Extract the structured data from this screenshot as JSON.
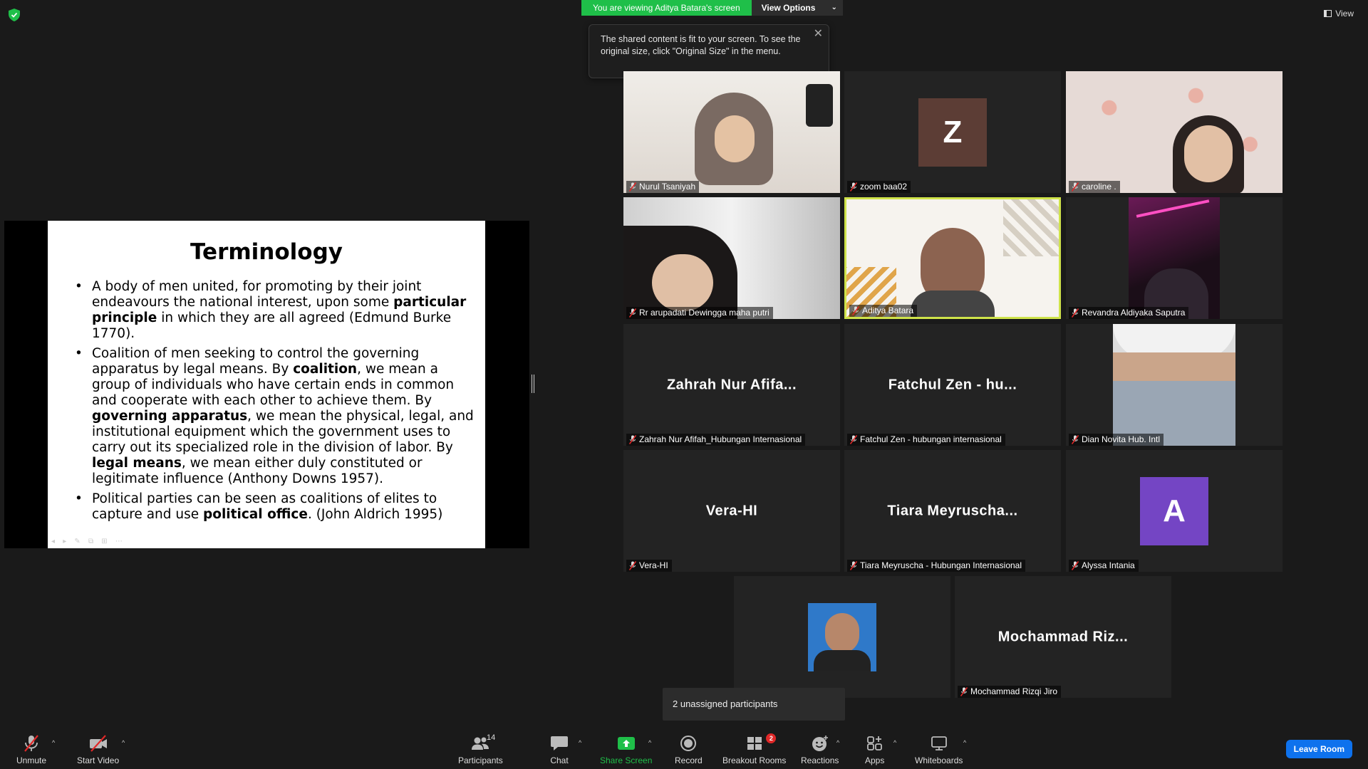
{
  "banner": {
    "viewing_text": "You are viewing Aditya Batara's screen",
    "view_options_label": "View Options"
  },
  "tooltip": {
    "text": "The shared content is fit to your screen. To see the original size, click \"Original Size\" in the menu."
  },
  "view_button_label": "View",
  "slide": {
    "title": "Terminology",
    "bullets": [
      [
        {
          "t": "A body of men united, for promoting by their joint endeavours the national interest, upon some ",
          "b": false
        },
        {
          "t": "particular principle",
          "b": true
        },
        {
          "t": " in which they are all agreed (Edmund Burke 1770).",
          "b": false
        }
      ],
      [
        {
          "t": "Coalition of men seeking to control the governing apparatus by legal means. By ",
          "b": false
        },
        {
          "t": "coalition",
          "b": true
        },
        {
          "t": ", we mean a group of individuals who have certain ends in common and cooperate with each other to achieve them. By ",
          "b": false
        },
        {
          "t": "governing apparatus",
          "b": true
        },
        {
          "t": ", we mean the physical, legal, and institutional equipment which the government uses to carry out its specialized role in the division of labor. By ",
          "b": false
        },
        {
          "t": "legal means",
          "b": true
        },
        {
          "t": ", we mean either duly constituted or legitimate influence (Anthony Downs 1957).",
          "b": false
        }
      ],
      [
        {
          "t": "Political parties can be seen as coalitions of elites to capture and use ",
          "b": false
        },
        {
          "t": "political office",
          "b": true
        },
        {
          "t": ". (John Aldrich 1995)",
          "b": false
        }
      ]
    ]
  },
  "participants": [
    {
      "name": "Nurul Tsaniyah",
      "kind": "video"
    },
    {
      "name": "zoom baa02",
      "kind": "letter",
      "letter": "Z",
      "color": "#5c3d35"
    },
    {
      "name": "caroline .",
      "kind": "video"
    },
    {
      "name": "Rr arupadati Dewingga maha putri",
      "kind": "video"
    },
    {
      "name": "Aditya Batara",
      "kind": "video",
      "active": true
    },
    {
      "name": "Revandra Aldiyaka Saputra",
      "kind": "video"
    },
    {
      "name": "Zahrah Nur Afifah_Hubungan Internasional",
      "kind": "text",
      "display": "Zahrah Nur Afifa..."
    },
    {
      "name": "Fatchul Zen - hubungan internasional",
      "kind": "text",
      "display": "Fatchul Zen - hu..."
    },
    {
      "name": "Dian Novita Hub. Intl",
      "kind": "video"
    },
    {
      "name": "Vera-HI",
      "kind": "text",
      "display": "Vera-HI"
    },
    {
      "name": "Tiara Meyruscha - Hubungan Internasional",
      "kind": "text",
      "display": "Tiara Meyruscha..."
    },
    {
      "name": "Alyssa Intania",
      "kind": "letter",
      "letter": "A",
      "color": "#7445c4"
    },
    {
      "name": "",
      "kind": "photo"
    },
    {
      "name": "Mochammad Rizqi Jiro",
      "kind": "text",
      "display": "Mochammad Riz..."
    }
  ],
  "unassigned_text": "2 unassigned participants",
  "toolbar": {
    "unmute": "Unmute",
    "start_video": "Start Video",
    "participants": "Participants",
    "participants_count": "14",
    "chat": "Chat",
    "share_screen": "Share Screen",
    "record": "Record",
    "breakout_rooms": "Breakout Rooms",
    "breakout_badge": "2",
    "reactions": "Reactions",
    "apps": "Apps",
    "whiteboards": "Whiteboards",
    "leave_room": "Leave Room"
  },
  "colors": {
    "banner_green": "#1fbf49",
    "active_border": "#cfe34a",
    "leave_blue": "#0e72ed",
    "share_green": "#1fbf49",
    "badge_red": "#e02828"
  }
}
